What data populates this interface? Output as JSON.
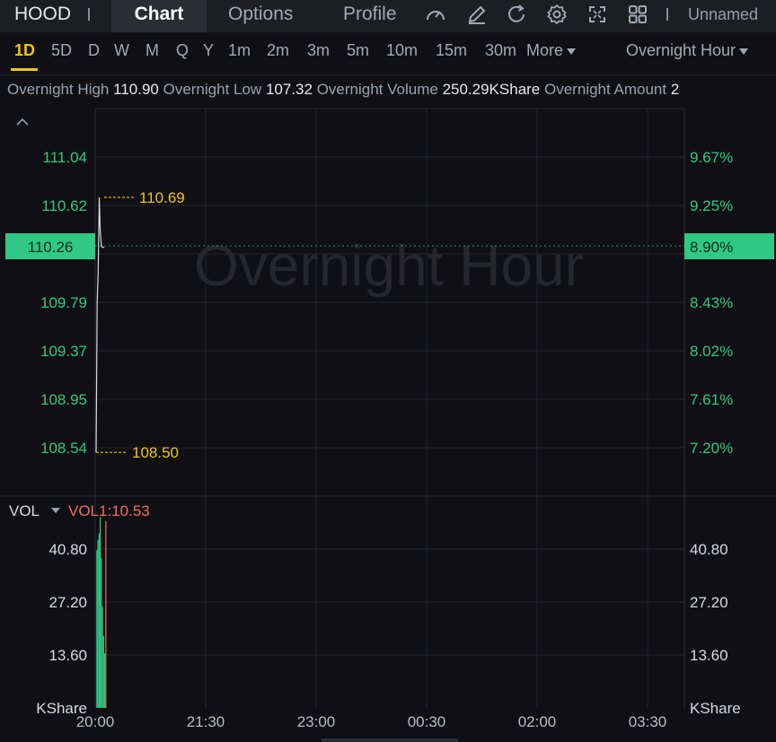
{
  "topbar": {
    "ticker": "HOOD",
    "tabs": [
      "Chart",
      "Options",
      "Profile"
    ],
    "active_tab": "Chart",
    "icons": [
      "speed-icon",
      "draw-icon",
      "refresh-icon",
      "settings-icon",
      "fullscreen-icon",
      "layout-icon"
    ],
    "layout_name": "Unnamed"
  },
  "timeframes": {
    "items": [
      "1D",
      "5D",
      "D",
      "W",
      "M",
      "Q",
      "Y",
      "1m",
      "2m",
      "3m",
      "5m",
      "10m",
      "15m",
      "30m"
    ],
    "more": "More",
    "active": "1D",
    "session": "Overnight Hour"
  },
  "stats": {
    "high_label": "Overnight High",
    "high": "110.90",
    "low_label": "Overnight Low",
    "low": "107.32",
    "volume_label": "Overnight Volume",
    "volume": "250.29KShare",
    "amount_label": "Overnight Amount",
    "amount": "2"
  },
  "colors": {
    "up": "#2fc884",
    "down": "#f26b6b",
    "accent": "#f0c419",
    "price_line": "#d8dae0"
  },
  "chart_data": [
    {
      "type": "line",
      "title": "",
      "watermark": "Overnight Hour",
      "y_ticks": [
        "111.04",
        "110.62",
        "109.79",
        "109.37",
        "108.95",
        "108.54"
      ],
      "y_pct_ticks": [
        "9.67%",
        "9.25%",
        "8.43%",
        "8.02%",
        "7.61%",
        "7.20%"
      ],
      "ylim": [
        108.26,
        111.35
      ],
      "last_price": "110.26",
      "last_pct": "8.90%",
      "max_mark": "110.69",
      "min_mark": "108.50",
      "x_ticks": [
        "20:00",
        "21:30",
        "23:00",
        "00:30",
        "02:00",
        "03:30"
      ],
      "x_range_min": [
        0,
        470
      ],
      "series": [
        {
          "x": [
            0,
            1,
            2,
            3,
            4,
            5,
            6,
            7,
            8
          ],
          "values": [
            108.5,
            109.8,
            110.05,
            110.69,
            110.4,
            110.28,
            110.26,
            110.26,
            110.26
          ]
        }
      ]
    },
    {
      "type": "bar",
      "title": "",
      "indicator": "VOL",
      "indicator_value": "VOL1:10.53",
      "unit": "KShare",
      "y_ticks": [
        "40.80",
        "27.20",
        13.6
      ],
      "y_tick_labels": [
        "40.80",
        "27.20",
        "13.60"
      ],
      "ylim": [
        0,
        48
      ],
      "x_range_min": [
        0,
        470
      ],
      "series": [
        {
          "name": "up",
          "x": [
            1,
            2,
            3,
            4,
            5,
            6,
            7,
            8
          ],
          "values": [
            40.5,
            43.2,
            44.8,
            49.0,
            38.5,
            26.0,
            18.5,
            14.0
          ]
        },
        {
          "name": "down",
          "x": [
            9
          ],
          "values": [
            48.0
          ]
        }
      ]
    }
  ]
}
